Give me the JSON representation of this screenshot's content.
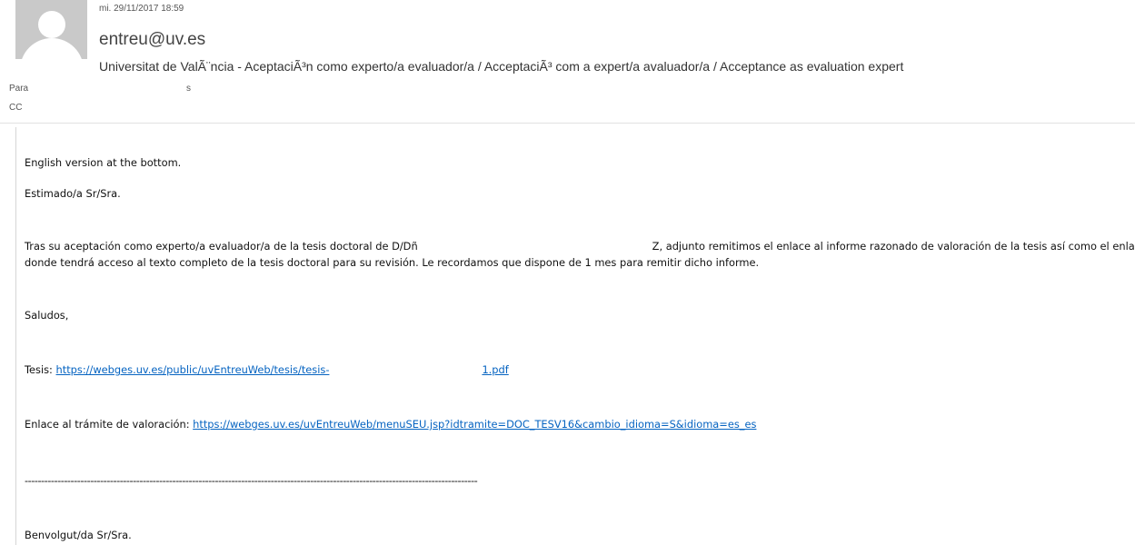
{
  "header": {
    "date": "mi. 29/11/2017 18:59",
    "sender": "entreu@uv.es",
    "subject": "Universitat de ValÃ¨ncia - AceptaciÃ³n como experto/a evaluador/a / AcceptaciÃ³ com a expert/a avaluador/a / Acceptance as evaluation expert",
    "to_label": "Para",
    "to_value": "s",
    "cc_label": "CC"
  },
  "body": {
    "english_note": "English version at the bottom.",
    "greeting": "Estimado/a Sr/Sra.",
    "para1_part1": "Tras su aceptación como experto/a evaluador/a de la tesis doctoral de D/Dñ",
    "para1_part2": "Z, adjunto remitimos el enlace al informe razonado de valoración de la tesis así como el enlace",
    "para1_line2": "donde tendrá acceso al texto completo de la tesis doctoral para su revisión. Le recordamos que dispone de 1 mes para remitir dicho informe.",
    "closing": "Saludos,",
    "tesis_label": "Tesis: ",
    "tesis_link_part1": "https://webges.uv.es/public/uvEntreuWeb/tesis/tesis-",
    "tesis_link_part2": "1.pdf",
    "enlace_label": "Enlace al trámite de valoración: ",
    "enlace_link": "https://webges.uv.es/uvEntreuWeb/menuSEU.jsp?idtramite=DOC_TESV16&cambio_idioma=S&idioma=es_es",
    "separator": "------------------------------------------------------------------------------------------------------------------------------------------",
    "greeting_va": "Benvolgut/da Sr/Sra."
  }
}
